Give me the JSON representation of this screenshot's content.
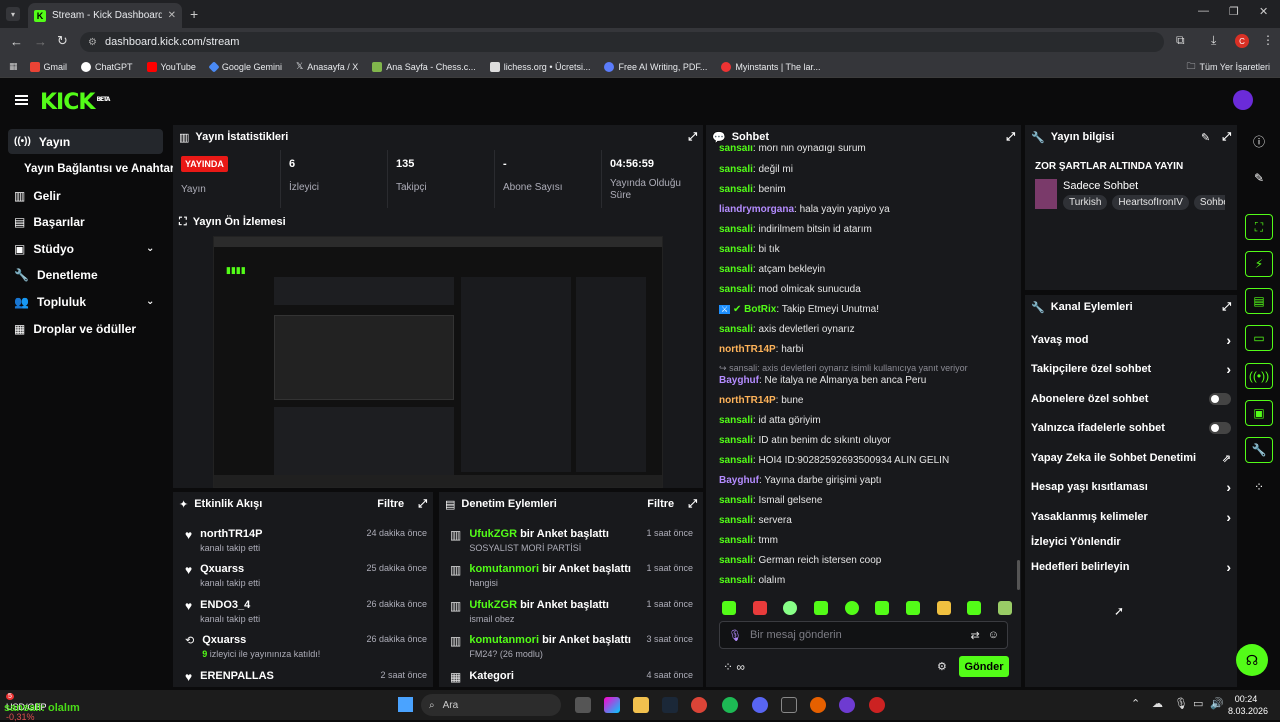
{
  "browser": {
    "tab_title": "Stream - Kick Dashboard",
    "url": "dashboard.kick.com/stream",
    "bookmarks": [
      "Gmail",
      "ChatGPT",
      "YouTube",
      "Google Gemini",
      "Anasayfa / X",
      "Ana Sayfa - Chess.c...",
      "lichess.org • Ücretsi...",
      "Free AI Writing, PDF...",
      "Myinstants | The lar..."
    ],
    "bookmarks_right": "Tüm Yer İşaretleri",
    "profile_initial": "C"
  },
  "kick": {
    "logo": "KICK",
    "logo_sup": "BETA"
  },
  "nav": [
    {
      "label": "Yayın",
      "icon": "broadcast-icon"
    },
    {
      "label": "Yayın Bağlantısı ve Anahtarı",
      "icon": ""
    },
    {
      "label": "Gelir",
      "icon": "chart-icon"
    },
    {
      "label": "Başarılar",
      "icon": "trophy-icon"
    },
    {
      "label": "Stüdyo",
      "icon": "studio-icon"
    },
    {
      "label": "Denetleme",
      "icon": "wrench-icon"
    },
    {
      "label": "Topluluk",
      "icon": "community-icon"
    },
    {
      "label": "Droplar ve ödüller",
      "icon": "gift-icon"
    }
  ],
  "stats": {
    "title": "Yayın İstatistikleri",
    "live_badge": "YAYINDA",
    "items": [
      {
        "value": "",
        "label": "Yayın"
      },
      {
        "value": "6",
        "label": "İzleyici"
      },
      {
        "value": "135",
        "label": "Takipçi"
      },
      {
        "value": "-",
        "label": "Abone Sayısı"
      },
      {
        "value": "04:56:59",
        "label": "Yayında Olduğu Süre"
      }
    ]
  },
  "preview": {
    "title": "Yayın Ön İzlemesi"
  },
  "activity": {
    "title": "Etkinlik Akışı",
    "filter": "Filtre",
    "items": [
      {
        "name": "northTR14P",
        "desc": "kanalı takip etti",
        "time": "24 dakika önce",
        "icon": "heart-icon"
      },
      {
        "name": "Qxuarss",
        "desc": "kanalı takip etti",
        "time": "25 dakika önce",
        "icon": "heart-icon"
      },
      {
        "name": "ENDO3_4",
        "desc": "kanalı takip etti",
        "time": "26 dakika önce",
        "icon": "heart-icon"
      },
      {
        "name": "Qxuarss",
        "desc_num": "9",
        "desc": " izleyici ile yayınınıza katıldı!",
        "time": "26 dakika önce",
        "icon": "raid-icon"
      },
      {
        "name": "ERENPALLAS",
        "desc": "",
        "time": "2 saat önce",
        "icon": "heart-icon"
      }
    ]
  },
  "moderation": {
    "title": "Denetim Eylemleri",
    "filter": "Filtre",
    "items": [
      {
        "user": "UfukZGR",
        "action": " bir Anket başlattı",
        "detail": "SOSYALIST MORİ PARTİSİ",
        "time": "1 saat önce"
      },
      {
        "user": "komutanmori",
        "action": " bir Anket başlattı",
        "detail": "hangisi",
        "time": "1 saat önce"
      },
      {
        "user": "UfukZGR",
        "action": " bir Anket başlattı",
        "detail": "ismail obez",
        "time": "1 saat önce"
      },
      {
        "user": "komutanmori",
        "action": " bir Anket başlattı",
        "detail": "FM24? (26 modlu)",
        "time": "3 saat önce"
      },
      {
        "user": "",
        "action": "Kategori",
        "detail": "",
        "time": "4 saat önce"
      }
    ]
  },
  "chat": {
    "title": "Sohbet",
    "placeholder": "Bir mesaj gönderin",
    "send": "Gönder",
    "messages": [
      {
        "user": "sansali",
        "text": ": mori nin oynadığı sürum",
        "c": "u"
      },
      {
        "user": "sansali",
        "text": ": değil mi",
        "c": "u"
      },
      {
        "user": "sansali",
        "text": ": benim",
        "c": "u"
      },
      {
        "user": "liandrymorgana",
        "text": ": hala yayin yapiyo ya",
        "c": "up"
      },
      {
        "user": "sansali",
        "text": ": indirilmem bitsin id atarım",
        "c": "u"
      },
      {
        "user": "sansali",
        "text": ": bi tık",
        "c": "u"
      },
      {
        "user": "sansali",
        "text": ": atçam bekleyin",
        "c": "u"
      },
      {
        "user": "sansali",
        "text": ": mod olmicak sunucuda",
        "c": "u"
      },
      {
        "user": "BotRix",
        "text": ": Takip Etmeyi Unutma!",
        "c": "u"
      },
      {
        "user": "sansali",
        "text": ": axis devletleri oynarız",
        "c": "u"
      },
      {
        "user": "northTR14P",
        "text": ": harbi",
        "c": "uo"
      },
      {
        "user": "",
        "text": "sansali: axis devletleri oynarız isimli kullanıcıya yanıt veriyor",
        "c": "reply"
      },
      {
        "user": "Bayghuf",
        "text": ": Ne italya ne Almanya ben anca Peru",
        "c": "up"
      },
      {
        "user": "northTR14P",
        "text": ": bune",
        "c": "uo"
      },
      {
        "user": "sansali",
        "text": ": id atta göriyim",
        "c": "u"
      },
      {
        "user": "sansali",
        "text": ": İD atın benim dc sıkıntı oluyor",
        "c": "u"
      },
      {
        "user": "sansali",
        "text": ": HOİ4 İD:90282592693500934 ALIN GELİN",
        "c": "u"
      },
      {
        "user": "Bayghuf",
        "text": ": Yayına darbe girişimi yaptı",
        "c": "up"
      },
      {
        "user": "sansali",
        "text": ": İsmail gelsene",
        "c": "u"
      },
      {
        "user": "sansali",
        "text": ": servera",
        "c": "u"
      },
      {
        "user": "sansali",
        "text": ": tmm",
        "c": "u"
      },
      {
        "user": "sansali",
        "text": ": German reich istersen coop",
        "c": "u"
      },
      {
        "user": "sansali",
        "text": ": olalım",
        "c": "u"
      }
    ]
  },
  "info": {
    "title": "Yayın bilgisi",
    "stream_title": "ZOR ŞARTLAR ALTINDA YAYIN",
    "category": "Sadece Sohbet",
    "tags": [
      "Turkish",
      "HeartsofIronIV",
      "Sohbe"
    ]
  },
  "channel": {
    "title": "Kanal Eylemleri",
    "actions": [
      {
        "label": "Yavaş mod",
        "type": "chevron"
      },
      {
        "label": "Takipçilere özel sohbet",
        "type": "chevron"
      },
      {
        "label": "Abonelere özel sohbet",
        "type": "toggle"
      },
      {
        "label": "Yalnızca ifadelerle sohbet",
        "type": "toggle"
      },
      {
        "label": "Yapay Zeka ile Sohbet Denetimi",
        "type": "external"
      },
      {
        "label": "Hesap yaşı kısıtlaması",
        "type": "chevron"
      },
      {
        "label": "Yasaklanmış kelimeler",
        "type": "chevron"
      },
      {
        "label": "İzleyici Yönlendir",
        "type": "none"
      },
      {
        "label": "Hedefleri belirleyin",
        "type": "chevron"
      }
    ]
  },
  "taskbar": {
    "search": "Ara",
    "currency": "USD/GBP",
    "currency_change": "-0,31%",
    "overlay_text": "sansali: olalım",
    "time": "00:24",
    "date": "8.03.2026"
  },
  "colors": {
    "accent": "#53fc18",
    "panel": "#18191c",
    "bg": "#0b0b0c"
  }
}
